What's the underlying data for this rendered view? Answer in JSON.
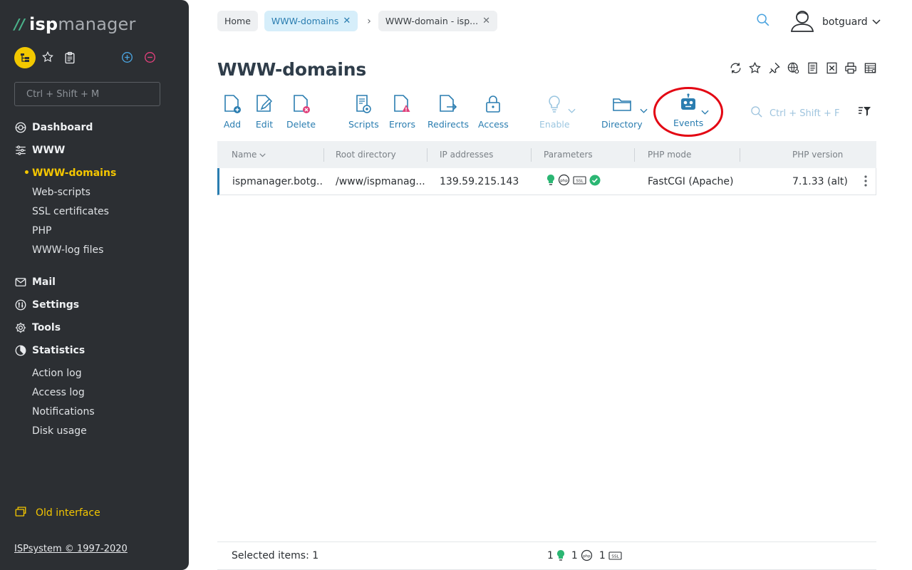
{
  "sidebar": {
    "logo_prefix": "//",
    "logo_isp": "isp",
    "logo_manager": "manager",
    "search_placeholder": "Ctrl + Shift + M",
    "nav": {
      "dashboard": "Dashboard",
      "www": "WWW",
      "www_items": [
        "WWW-domains",
        "Web-scripts",
        "SSL certificates",
        "PHP",
        "WWW-log files"
      ],
      "mail": "Mail",
      "settings": "Settings",
      "tools": "Tools",
      "statistics": "Statistics",
      "statistics_items": [
        "Action log",
        "Access log",
        "Notifications",
        "Disk usage"
      ]
    },
    "old_interface": "Old interface",
    "copyright": "ISPsystem © 1997-2020"
  },
  "header": {
    "breadcrumbs": [
      {
        "label": "Home"
      },
      {
        "label": "WWW-domains"
      },
      {
        "label": "WWW-domain - isp..."
      }
    ],
    "breadcrumb_separator": "›",
    "user": "botguard"
  },
  "page": {
    "title": "WWW-domains"
  },
  "toolbar": {
    "add": "Add",
    "edit": "Edit",
    "delete": "Delete",
    "scripts": "Scripts",
    "errors": "Errors",
    "redirects": "Redirects",
    "access": "Access",
    "enable": "Enable",
    "directory": "Directory",
    "events": "Events",
    "search_placeholder": "Ctrl + Shift + F"
  },
  "table": {
    "columns": [
      "Name",
      "Root directory",
      "IP addresses",
      "Parameters",
      "PHP mode",
      "PHP version"
    ],
    "rows": [
      {
        "name": "ispmanager.botg...",
        "root": "/www/ispmanag...",
        "ip": "139.59.215.143",
        "php_mode": "FastCGI (Apache)",
        "php_version": "7.1.33 (alt)"
      }
    ]
  },
  "footer": {
    "selected": "Selected items: 1",
    "count_bulb": "1",
    "count_php": "1",
    "count_ssl": "1"
  },
  "colors": {
    "sidebar_bg": "#2c2f33",
    "accent_blue": "#2a7db0",
    "accent_yellow": "#f4c600",
    "highlight_red": "#e30613",
    "success_green": "#2bb673"
  }
}
